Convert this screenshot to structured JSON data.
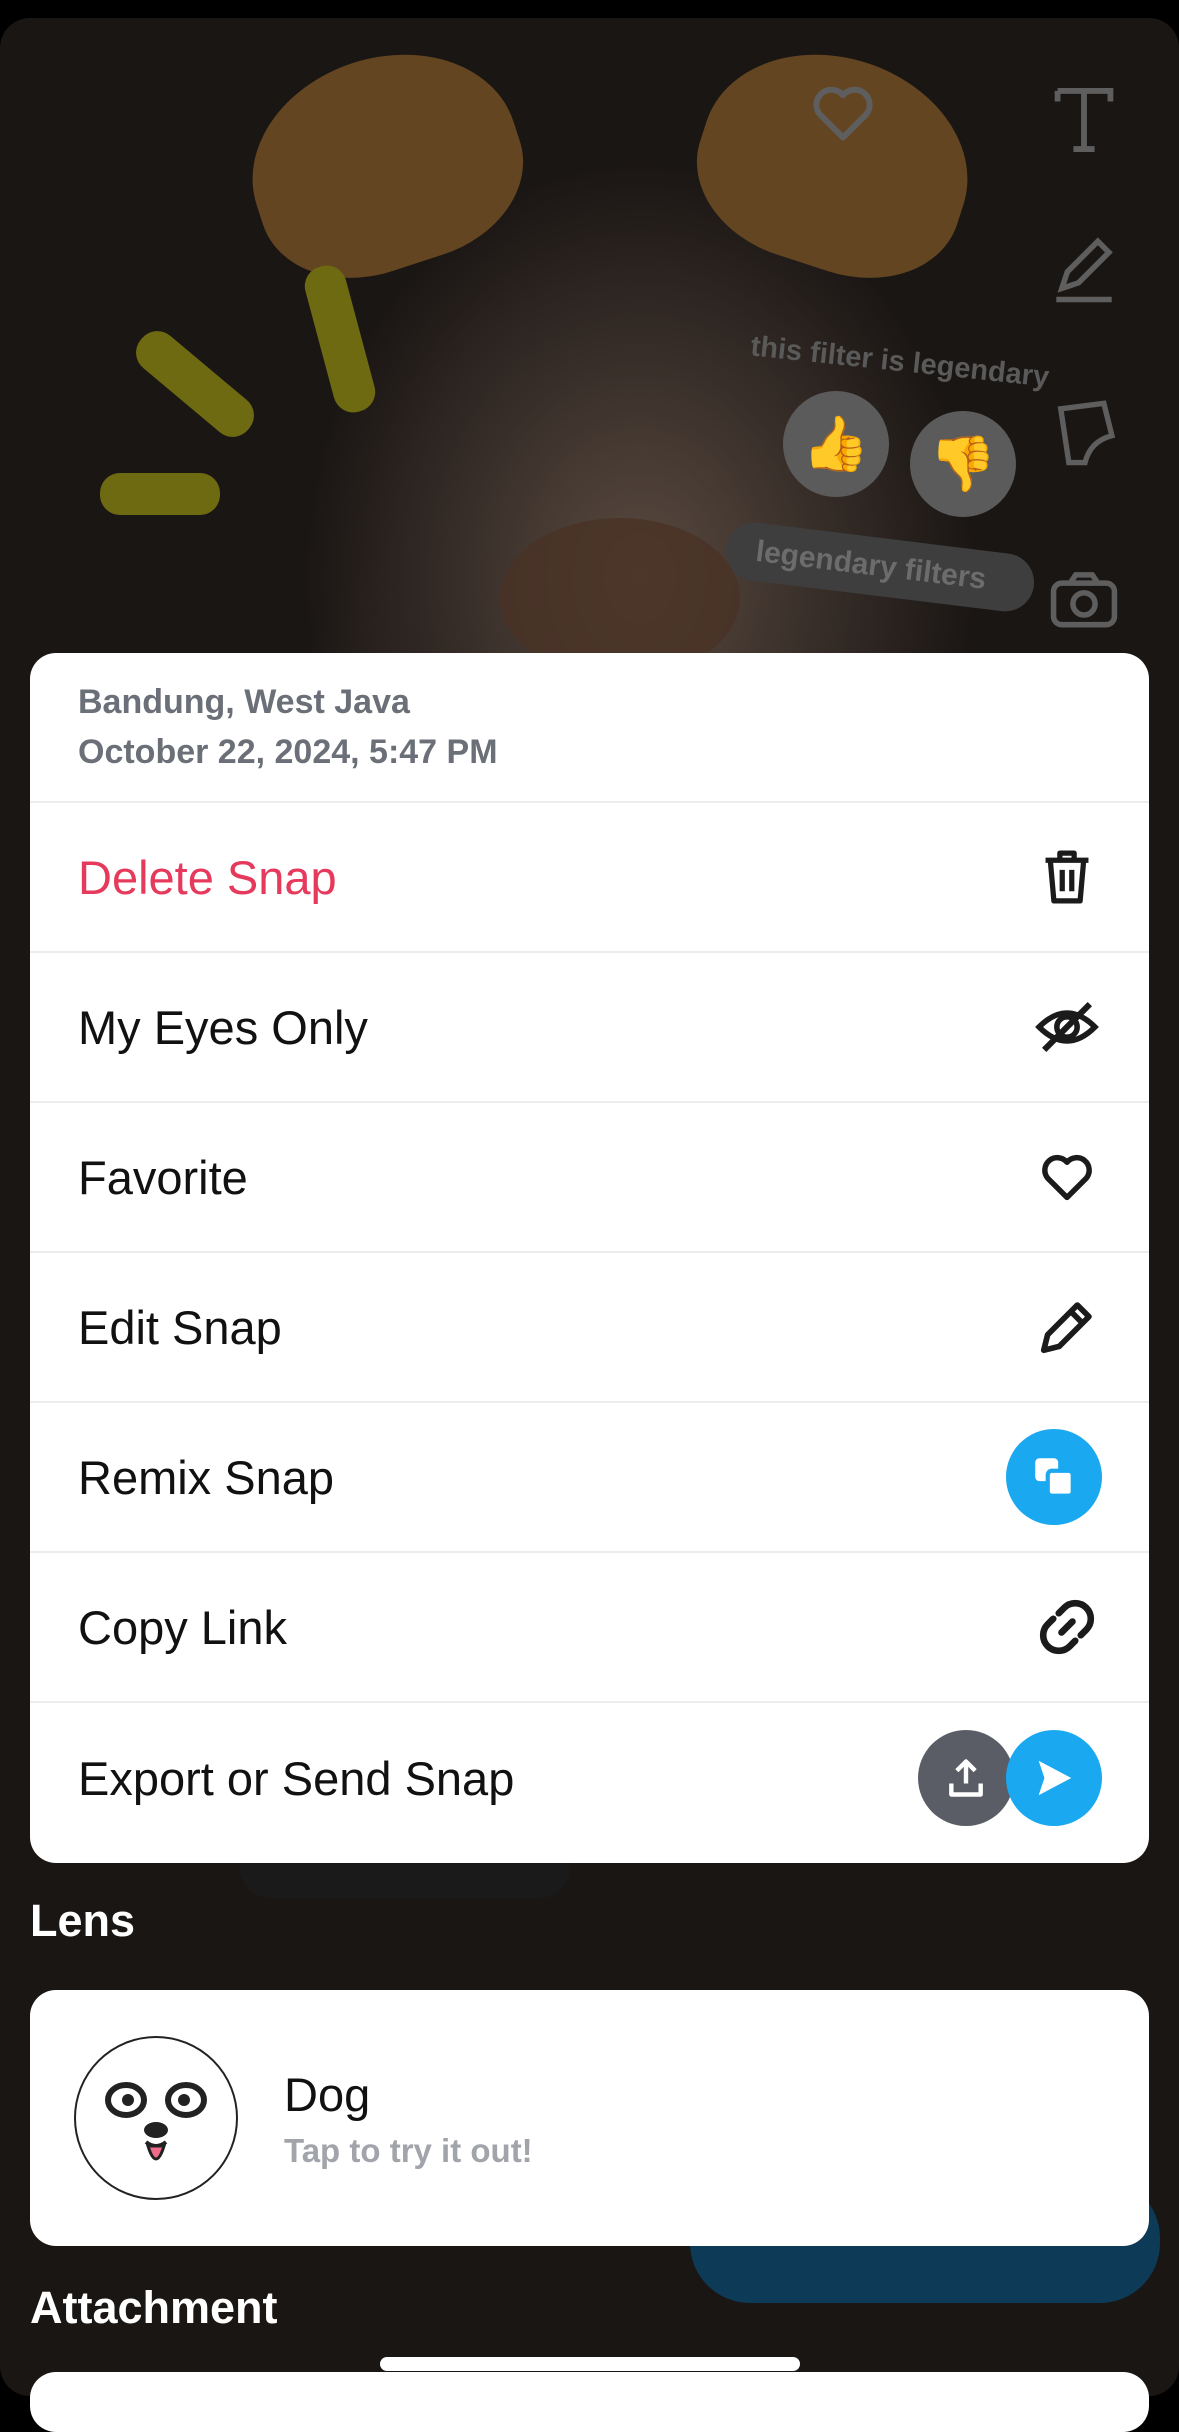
{
  "camera_overlay": {
    "filter_prompt": "this filter is legendary",
    "thumbs_up": "👍",
    "thumbs_down": "👎",
    "pill_text": "legendary filters",
    "right_tools": [
      "heart-icon",
      "text-icon",
      "pencil-icon",
      "sticker-icon",
      "camera-flip-icon"
    ]
  },
  "menu": {
    "location": "Bandung, West Java",
    "datetime": "October 22, 2024, 5:47 PM",
    "items": [
      {
        "label": "Delete Snap",
        "icon": "trash-icon",
        "color": "#e63a5c"
      },
      {
        "label": "My Eyes Only",
        "icon": "eye-slash-icon"
      },
      {
        "label": "Favorite",
        "icon": "heart-icon"
      },
      {
        "label": "Edit Snap",
        "icon": "pencil-icon"
      },
      {
        "label": "Remix Snap",
        "icon": "remix-icon",
        "color": "#1aa8f0"
      },
      {
        "label": "Copy Link",
        "icon": "link-icon"
      },
      {
        "label": "Export or Send Snap",
        "icon": "export-icon",
        "icon2": "send-icon"
      }
    ]
  },
  "lens": {
    "section_title": "Lens",
    "name": "Dog",
    "subtitle": "Tap to try it out!"
  },
  "attachment": {
    "section_title": "Attachment"
  }
}
